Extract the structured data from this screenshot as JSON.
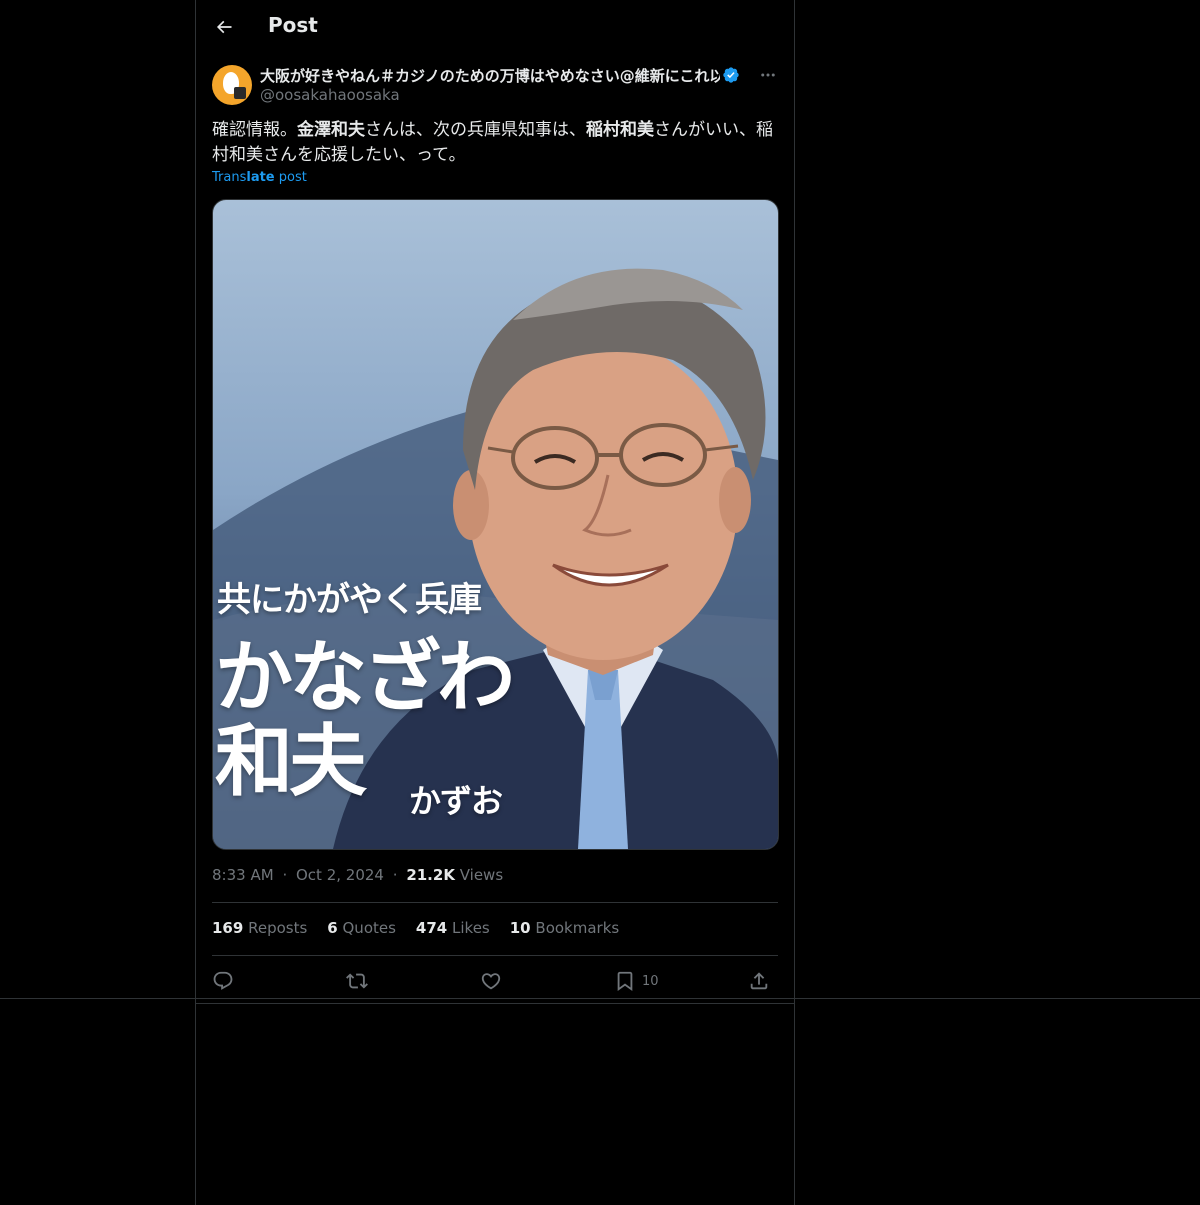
{
  "header": {
    "title": "Post"
  },
  "author": {
    "name": "大阪が好きやねん＃カジノのための万博はやめなさい@維新にこれ以上",
    "handle": "@oosakahaoosaka"
  },
  "post": {
    "text_1": "確認情報。",
    "bold_1": "金澤和夫",
    "text_2": "さんは、次の兵庫県知事は、",
    "bold_2": "稲村和美",
    "text_3": "さんがいい、稲村和美さんを応援したい、って。",
    "translate_prefix": "Trans",
    "translate_bold": "late",
    "translate_suffix": " post"
  },
  "image": {
    "line1": "共にかがやく兵庫",
    "line2": "かなざわ",
    "line3": "和夫",
    "line4": "かずお"
  },
  "meta": {
    "time": "8:33 AM",
    "date": "Oct 2, 2024",
    "dot": "·",
    "views_count": "21.2K",
    "views_label": "Views"
  },
  "stats": {
    "reposts_count": "169",
    "reposts_label": "Reposts",
    "quotes_count": "6",
    "quotes_label": "Quotes",
    "likes_count": "474",
    "likes_label": "Likes",
    "bookmarks_count": "10",
    "bookmarks_label": "Bookmarks"
  },
  "actions": {
    "bookmark_count": "10"
  },
  "colors": {
    "accent": "#1d9bf0",
    "background": "#000000",
    "border": "#2f3336",
    "muted": "#71767b"
  }
}
